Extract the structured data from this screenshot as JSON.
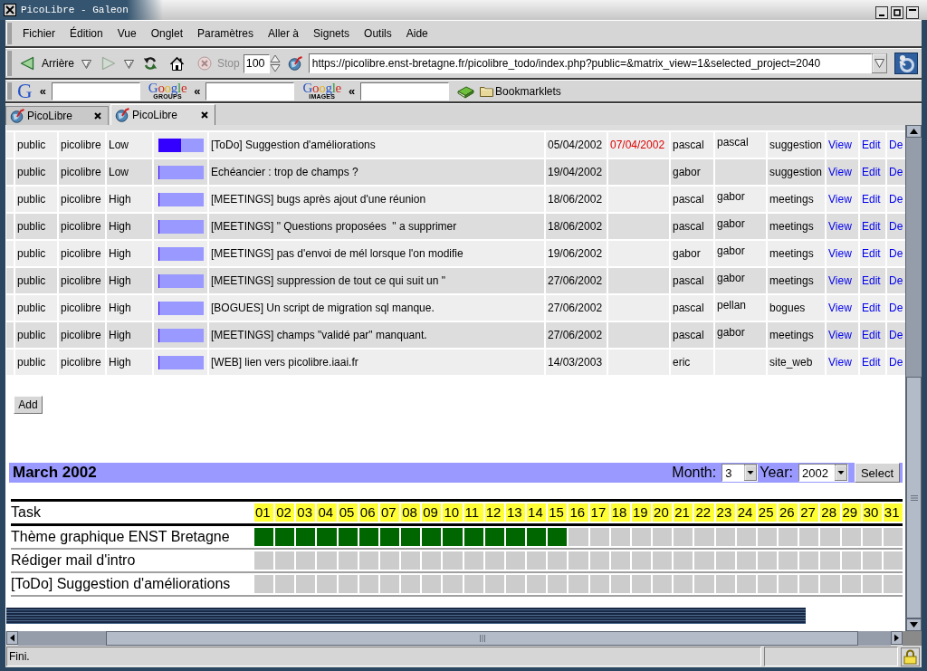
{
  "window": {
    "title": "PicoLibre - Galeon"
  },
  "menu": [
    "Fichier",
    "Édition",
    "Vue",
    "Onglet",
    "Paramètres",
    "Aller à",
    "Signets",
    "Outils",
    "Aide"
  ],
  "nav_buttons": [
    {
      "kind": "back",
      "label": "Arrière",
      "disabled": false
    },
    {
      "kind": "back_history",
      "disabled": false
    },
    {
      "kind": "forward",
      "disabled": true
    },
    {
      "kind": "forward_history",
      "disabled": false
    },
    {
      "kind": "reload",
      "disabled": false
    },
    {
      "kind": "home",
      "disabled": false
    },
    {
      "kind": "stop",
      "label": "Stop",
      "disabled": true
    }
  ],
  "zoom": {
    "value": "100"
  },
  "address": {
    "value": "https://picolibre.enst-bretagne.fr/picolibre_todo/index.php?public=&matrix_view=1&selected_project=2040"
  },
  "search_boxes": [
    {
      "kind": "plain",
      "logo": "G",
      "arrow": "«"
    },
    {
      "kind": "sub",
      "logo": "Google",
      "sublabel": "GROUPS",
      "arrow": "«"
    },
    {
      "kind": "sub",
      "logo": "Google",
      "sublabel": "IMAGES",
      "arrow": "«"
    }
  ],
  "bookmarks": {
    "folder": "Bookmarklets"
  },
  "tabs": [
    {
      "label": "PicoLibre",
      "selected": false
    },
    {
      "label": "PicoLibre",
      "selected": true
    }
  ],
  "todo_table": {
    "rows": [
      {
        "column_1": "public",
        "column_2": "picolibre",
        "column_3": "Low",
        "column_4": {
          "level": 0.5
        },
        "column_5": "[ToDo] Suggestion d'améliorations",
        "column_6": "05/04/2002",
        "column_7": {
          "text": "07/04/2002",
          "overdue": true
        },
        "column_8": "pascal",
        "column_9": "pascal",
        "column_10": "suggestion",
        "links": [
          "View",
          "Edit",
          "De"
        ]
      },
      {
        "column_1": "public",
        "column_2": "picolibre",
        "column_3": "Low",
        "column_4": {
          "level": 0
        },
        "column_5": "Echéancier : trop de champs ?",
        "column_6": "19/04/2002",
        "column_8": "gabor",
        "column_10": "suggestion",
        "links": [
          "View",
          "Edit",
          "De"
        ]
      },
      {
        "column_1": "public",
        "column_2": "picolibre",
        "column_3": "High",
        "column_4": {
          "level": 0
        },
        "column_5": "[MEETINGS] bugs après ajout d'une réunion",
        "column_6": "18/06/2002",
        "column_8": "pascal",
        "column_9": "gabor",
        "column_10": "meetings",
        "links": [
          "View",
          "Edit",
          "De"
        ]
      },
      {
        "column_1": "public",
        "column_2": "picolibre",
        "column_3": "High",
        "column_4": {
          "level": 0
        },
        "column_5": "[MEETINGS] \" Questions proposées  \" a supprimer",
        "column_6": "18/06/2002",
        "column_8": "pascal",
        "column_9": "gabor",
        "column_10": "meetings",
        "links": [
          "View",
          "Edit",
          "De"
        ]
      },
      {
        "column_1": "public",
        "column_2": "picolibre",
        "column_3": "High",
        "column_4": {
          "level": 0
        },
        "column_5": "[MEETINGS] pas d'envoi de mél lorsque l'on modifie",
        "column_6": "19/06/2002",
        "column_8": "gabor",
        "column_9": "gabor",
        "column_10": "meetings",
        "links": [
          "View",
          "Edit",
          "De"
        ]
      },
      {
        "column_1": "public",
        "column_2": "picolibre",
        "column_3": "High",
        "column_4": {
          "level": 0
        },
        "column_5": "[MEETINGS] suppression de tout ce qui suit un \"",
        "column_6": "27/06/2002",
        "column_8": "pascal",
        "column_9": "gabor",
        "column_10": "meetings",
        "links": [
          "View",
          "Edit",
          "De"
        ]
      },
      {
        "column_1": "public",
        "column_2": "picolibre",
        "column_3": "High",
        "column_4": {
          "level": 0
        },
        "column_5": "[BOGUES] Un script de migration sql manque.",
        "column_6": "27/06/2002",
        "column_8": "pascal",
        "column_9": "pellan",
        "column_10": "bogues",
        "links": [
          "View",
          "Edit",
          "De"
        ]
      },
      {
        "column_1": "public",
        "column_2": "picolibre",
        "column_3": "High",
        "column_4": {
          "level": 0
        },
        "column_5": "[MEETINGS] champs \"validé par\" manquant.",
        "column_6": "27/06/2002",
        "column_8": "pascal",
        "column_9": "gabor",
        "column_10": "meetings",
        "links": [
          "View",
          "Edit",
          "De"
        ]
      },
      {
        "column_1": "public",
        "column_2": "picolibre",
        "column_3": "High",
        "column_4": {
          "level": 0
        },
        "column_5": "[WEB] lien vers picolibre.iaai.fr",
        "column_6": "14/03/2003",
        "column_8": "eric",
        "column_10": "site_web",
        "links": [
          "View",
          "Edit",
          "De"
        ]
      }
    ]
  },
  "add_button": "Add",
  "calendar": {
    "title": "March 2002",
    "month_label": "Month:",
    "month": "3",
    "year_label": "Year:",
    "year": "2002",
    "select_button": "Select",
    "task_header": "Task",
    "days": [
      "01",
      "02",
      "03",
      "04",
      "05",
      "06",
      "07",
      "08",
      "09",
      "10",
      "11",
      "12",
      "13",
      "14",
      "15",
      "16",
      "17",
      "18",
      "19",
      "20",
      "21",
      "22",
      "23",
      "24",
      "25",
      "26",
      "27",
      "28",
      "29",
      "30",
      "31"
    ],
    "tasks": [
      {
        "name": "Thème graphique ENST Bretagne",
        "filled": [
          true,
          true,
          true,
          true,
          true,
          true,
          true,
          true,
          true,
          true,
          true,
          true,
          true,
          true,
          true,
          false,
          false,
          false,
          false,
          false,
          false,
          false,
          false,
          false,
          false,
          false,
          false,
          false,
          false,
          false,
          false
        ]
      },
      {
        "name": "Rédiger mail d'intro",
        "filled": [
          false,
          false,
          false,
          false,
          false,
          false,
          false,
          false,
          false,
          false,
          false,
          false,
          false,
          false,
          false,
          false,
          false,
          false,
          false,
          false,
          false,
          false,
          false,
          false,
          false,
          false,
          false,
          false,
          false,
          false,
          false
        ]
      },
      {
        "name": "[ToDo] Suggestion d'améliorations",
        "filled": [
          false,
          false,
          false,
          false,
          false,
          false,
          false,
          false,
          false,
          false,
          false,
          false,
          false,
          false,
          false,
          false,
          false,
          false,
          false,
          false,
          false,
          false,
          false,
          false,
          false,
          false,
          false,
          false,
          false,
          false,
          false
        ]
      }
    ]
  },
  "status_bar": {
    "text": "Fini."
  }
}
